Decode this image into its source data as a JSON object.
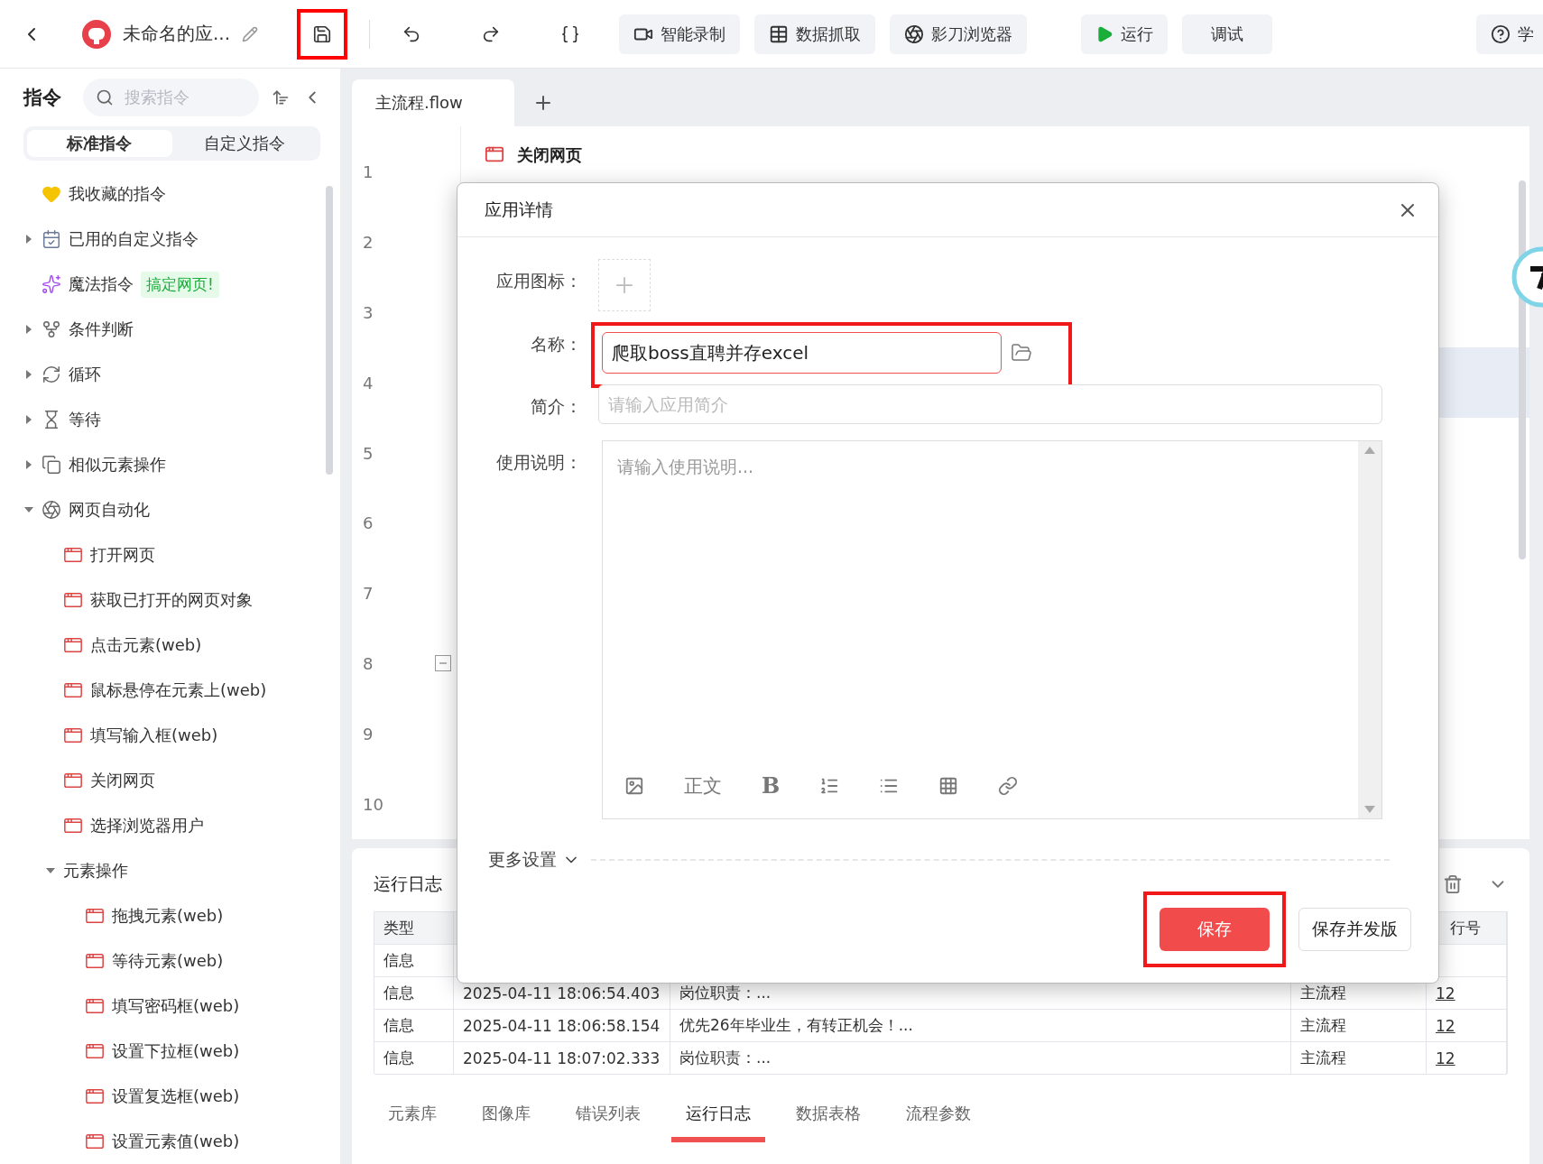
{
  "toolbar": {
    "app_title": "未命名的应...",
    "save_highlighted": true,
    "tools": [
      {
        "kind": "record",
        "label": "智能录制"
      },
      {
        "kind": "grab",
        "label": "数据抓取"
      },
      {
        "kind": "browser",
        "label": "影刀浏览器"
      }
    ],
    "run": "运行",
    "debug": "调试",
    "help": "学"
  },
  "sidebar": {
    "title": "指令",
    "search_placeholder": "搜索指令",
    "tabs": [
      {
        "label": "标准指令",
        "selected": true
      },
      {
        "label": "自定义指令",
        "selected": false
      }
    ],
    "items": [
      {
        "kind": "favorite",
        "label": "我收藏的指令"
      },
      {
        "kind": "custom",
        "label": "已用的自定义指令",
        "expanded": false
      },
      {
        "kind": "magic",
        "label": "魔法指令",
        "badge": "搞定网页!"
      },
      {
        "kind": "branch",
        "label": "条件判断",
        "expanded": false
      },
      {
        "kind": "loop",
        "label": "循环",
        "expanded": false
      },
      {
        "kind": "wait",
        "label": "等待",
        "expanded": false
      },
      {
        "kind": "similar",
        "label": "相似元素操作",
        "expanded": false
      },
      {
        "kind": "web",
        "label": "网页自动化",
        "expanded": true,
        "children": [
          {
            "kind": "page",
            "label": "打开网页"
          },
          {
            "kind": "page",
            "label": "获取已打开的网页对象"
          },
          {
            "kind": "page",
            "label": "点击元素(web)"
          },
          {
            "kind": "page",
            "label": "鼠标悬停在元素上(web)"
          },
          {
            "kind": "page",
            "label": "填写输入框(web)"
          },
          {
            "kind": "page",
            "label": "关闭网页"
          },
          {
            "kind": "page",
            "label": "选择浏览器用户"
          },
          {
            "kind": "group",
            "label": "元素操作",
            "expanded": true,
            "children": [
              {
                "kind": "page",
                "label": "拖拽元素(web)"
              },
              {
                "kind": "page",
                "label": "等待元素(web)"
              },
              {
                "kind": "page",
                "label": "填写密码框(web)"
              },
              {
                "kind": "page",
                "label": "设置下拉框(web)"
              },
              {
                "kind": "page",
                "label": "设置复选框(web)"
              },
              {
                "kind": "page",
                "label": "设置元素值(web)"
              }
            ]
          }
        ]
      }
    ]
  },
  "editor": {
    "tab": "主流程.flow",
    "lines": [
      {
        "number": "1",
        "selected": false,
        "collapsible": false
      },
      {
        "number": "2",
        "selected": false,
        "collapsible": false
      },
      {
        "number": "3",
        "selected": false,
        "collapsible": false
      },
      {
        "number": "4",
        "selected": true,
        "collapsible": false
      },
      {
        "number": "5",
        "selected": false,
        "collapsible": false
      },
      {
        "number": "6",
        "selected": false,
        "collapsible": false
      },
      {
        "number": "7",
        "selected": false,
        "collapsible": false
      },
      {
        "number": "8",
        "selected": false,
        "collapsible": true
      },
      {
        "number": "9",
        "selected": false,
        "collapsible": false
      },
      {
        "number": "10",
        "selected": false,
        "collapsible": false
      }
    ],
    "step": {
      "title": "关闭网页"
    }
  },
  "log": {
    "title": "运行日志",
    "header": {
      "type": "类型",
      "line": "行号"
    },
    "rows": [
      {
        "type": "信息"
      },
      {
        "type": "信息",
        "time": "2025-04-11 18:06:54.403",
        "message": "岗位职责：...",
        "flow": "主流程",
        "line": "12"
      },
      {
        "type": "信息",
        "time": "2025-04-11 18:06:58.154",
        "message": "优先26年毕业生，有转正机会！...",
        "flow": "主流程",
        "line": "12"
      },
      {
        "type": "信息",
        "time": "2025-04-11 18:07:02.333",
        "message": "岗位职责：...",
        "flow": "主流程",
        "line": "12"
      }
    ],
    "tabs": [
      {
        "label": "元素库",
        "selected": false
      },
      {
        "label": "图像库",
        "selected": false
      },
      {
        "label": "错误列表",
        "selected": false
      },
      {
        "label": "运行日志",
        "selected": true
      },
      {
        "label": "数据表格",
        "selected": false
      },
      {
        "label": "流程参数",
        "selected": false
      }
    ]
  },
  "dialog": {
    "title": "应用详情",
    "fields": [
      {
        "kind": "icon",
        "label": "应用图标："
      },
      {
        "kind": "name",
        "label": "名称：",
        "value": "爬取boss直聘并存excel",
        "highlighted": true
      },
      {
        "kind": "text",
        "label": "简介：",
        "placeholder": "请输入应用简介"
      },
      {
        "kind": "editor",
        "label": "使用说明：",
        "placeholder": "请输入使用说明...",
        "toolbar": [
          {
            "kind": "image"
          },
          {
            "kind": "text",
            "label": "正文"
          },
          {
            "kind": "bold",
            "label": "B"
          },
          {
            "kind": "ordered"
          },
          {
            "kind": "bullet"
          },
          {
            "kind": "table"
          },
          {
            "kind": "link"
          }
        ]
      }
    ],
    "more_settings": "更多设置",
    "buttons": [
      {
        "kind": "primary",
        "label": "保存",
        "highlighted": true
      },
      {
        "kind": "default",
        "label": "保存并发版",
        "highlighted": false
      }
    ]
  }
}
